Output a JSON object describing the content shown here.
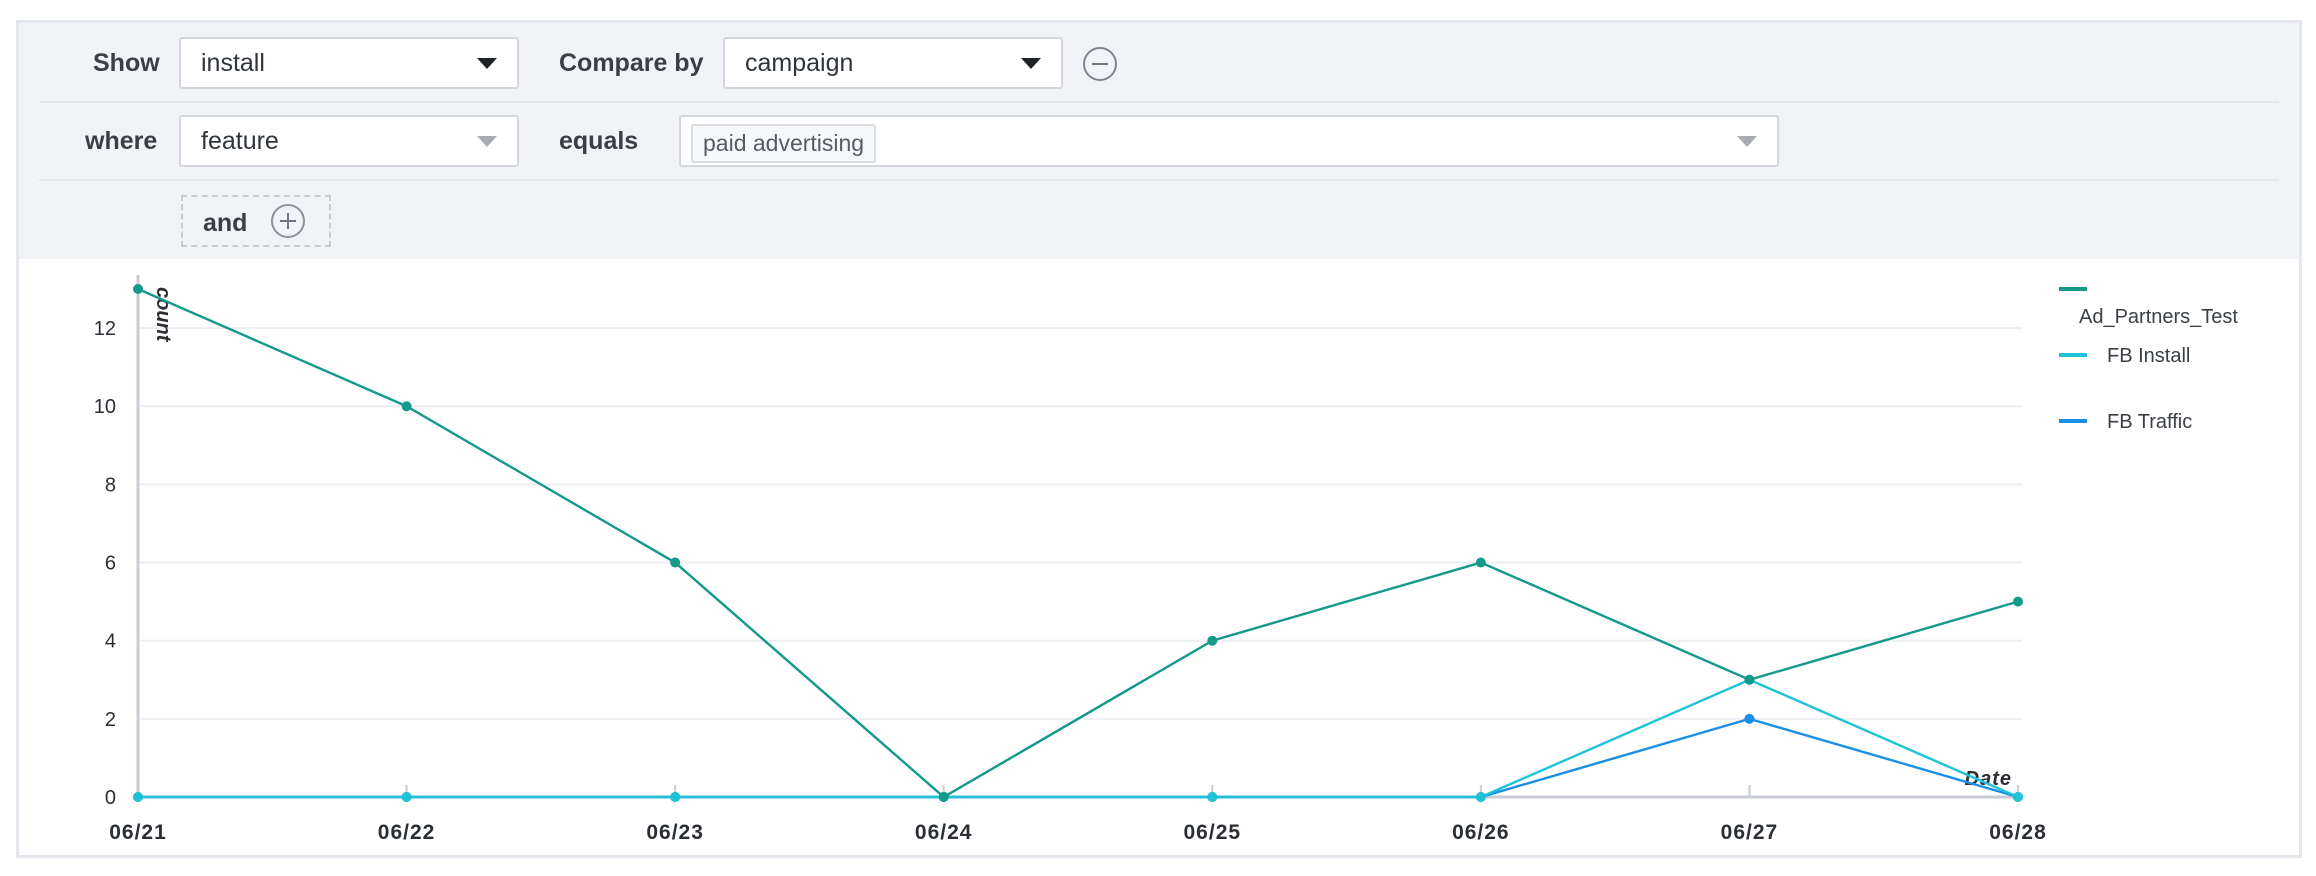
{
  "filters": {
    "show_label": "Show",
    "show_value": "install",
    "compare_label": "Compare by",
    "compare_value": "campaign",
    "where_label": "where",
    "where_value": "feature",
    "equals_label": "equals",
    "equals_tag": "paid advertising",
    "and_label": "and"
  },
  "chart_data": {
    "type": "line",
    "ylabel": "count",
    "xlabel": "Date",
    "categories": [
      "06/21",
      "06/22",
      "06/23",
      "06/24",
      "06/25",
      "06/26",
      "06/27",
      "06/28"
    ],
    "ylim": [
      0,
      13
    ],
    "yticks": [
      0,
      2,
      4,
      6,
      8,
      10,
      12
    ],
    "grid": true,
    "legend_position": "right",
    "series": [
      {
        "name": "Ad_Partners_Test",
        "color": "#14998a",
        "values": [
          13,
          10,
          6,
          0,
          4,
          6,
          3,
          5
        ]
      },
      {
        "name": "FB Install",
        "color": "#1ec3d8",
        "values": [
          0,
          0,
          0,
          0,
          0,
          0,
          3,
          0
        ]
      },
      {
        "name": "FB Traffic",
        "color": "#1a8fe6",
        "values": [
          0,
          0,
          0,
          0,
          0,
          0,
          2,
          0
        ]
      }
    ]
  }
}
